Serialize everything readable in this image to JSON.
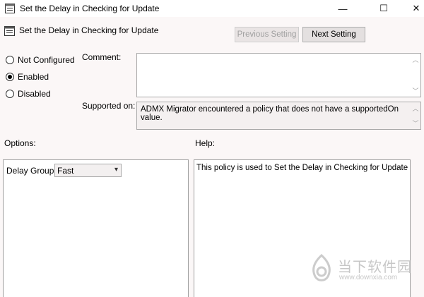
{
  "window": {
    "title": "Set the Delay in Checking for Update",
    "minimize_glyph": "—",
    "maximize_glyph": "☐",
    "close_glyph": "✕"
  },
  "header": {
    "title": "Set the Delay in Checking for Update",
    "previous_button": "Previous Setting",
    "next_button": "Next Setting"
  },
  "state": {
    "options": [
      {
        "label": "Not Configured",
        "checked": false
      },
      {
        "label": "Enabled",
        "checked": true
      },
      {
        "label": "Disabled",
        "checked": false
      }
    ]
  },
  "comment": {
    "label": "Comment:",
    "value": ""
  },
  "supported": {
    "label": "Supported on:",
    "value": "ADMX Migrator encountered a policy that does not have a supportedOn value."
  },
  "options_panel": {
    "label": "Options:",
    "field_label": "Delay Group",
    "selected_value": "Fast"
  },
  "help_panel": {
    "label": "Help:",
    "text": "This policy is used to Set the Delay in Checking for Update"
  },
  "watermark": {
    "cn": "当下软件园",
    "url": "www.downxia.com"
  }
}
